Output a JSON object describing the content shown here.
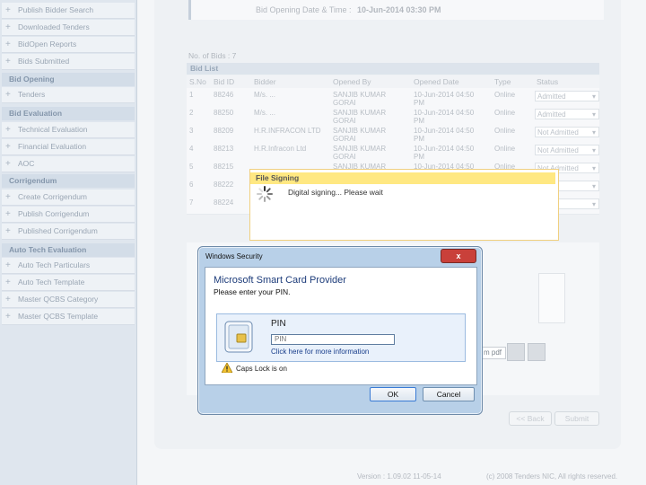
{
  "sidebar": {
    "items_top": [
      {
        "label": "Publish Bidder Search"
      },
      {
        "label": "Downloaded Tenders"
      },
      {
        "label": "BidOpen Reports"
      },
      {
        "label": "Bids Submitted"
      }
    ],
    "section_bid_opening": "Bid Opening",
    "bid_opening_items": [
      {
        "label": "Tenders"
      }
    ],
    "section_bid_evaluation": "Bid Evaluation",
    "bid_evaluation_items": [
      {
        "label": "Technical Evaluation"
      },
      {
        "label": "Financial Evaluation"
      },
      {
        "label": "AOC"
      }
    ],
    "section_corrigendum": "Corrigendum",
    "corrigendum_items": [
      {
        "label": "Create Corrigendum"
      },
      {
        "label": "Publish Corrigendum"
      },
      {
        "label": "Published Corrigendum"
      }
    ],
    "section_auto_tech": "Auto Tech Evaluation",
    "auto_tech_items": [
      {
        "label": "Auto Tech Particulars"
      },
      {
        "label": "Auto Tech Template"
      },
      {
        "label": "Master QCBS Category"
      },
      {
        "label": "Master QCBS Template"
      }
    ]
  },
  "main": {
    "opening_date_label": "Bid Opening Date & Time :",
    "opening_date_value": "10-Jun-2014 03:30 PM",
    "no_of_bids": "No. of Bids : 7",
    "bid_list_title": "Bid List",
    "columns": [
      "S.No",
      "Bid ID",
      "Bidder",
      "Opened By",
      "Opened Date",
      "Type",
      "Status"
    ],
    "rows": [
      {
        "sno": "1",
        "bid_id": "88246",
        "bidder": "M/s. ...",
        "opened_by": "SANJIB KUMAR GORAI",
        "opened_date": "10-Jun-2014 04:50 PM",
        "type": "Online",
        "status": "Admitted"
      },
      {
        "sno": "2",
        "bid_id": "88250",
        "bidder": "M/s. ...",
        "opened_by": "SANJIB KUMAR GORAI",
        "opened_date": "10-Jun-2014 04:50 PM",
        "type": "Online",
        "status": "Admitted"
      },
      {
        "sno": "3",
        "bid_id": "88209",
        "bidder": "H.R.INFRACON LTD",
        "opened_by": "SANJIB KUMAR GORAI",
        "opened_date": "10-Jun-2014 04:50 PM",
        "type": "Online",
        "status": "Not Admitted"
      },
      {
        "sno": "4",
        "bid_id": "88213",
        "bidder": "H.R.Infracon Ltd",
        "opened_by": "SANJIB KUMAR GORAI",
        "opened_date": "10-Jun-2014 04:50 PM",
        "type": "Online",
        "status": "Not Admitted"
      },
      {
        "sno": "5",
        "bid_id": "88215",
        "bidder": "",
        "opened_by": "SANJIB KUMAR",
        "opened_date": "10-Jun-2014 04:50",
        "type": "Online",
        "status": "Not Admitted"
      },
      {
        "sno": "6",
        "bid_id": "88222",
        "bidder": "",
        "opened_by": "",
        "opened_date": "",
        "type": "",
        "status": "...ted"
      },
      {
        "sno": "7",
        "bid_id": "88224",
        "bidder": "",
        "opened_by": "",
        "opened_date": "",
        "type": "",
        "status": "...ted"
      }
    ],
    "pdf_label": "m pdf",
    "back_label": "<< Back",
    "submit_label": "Submit"
  },
  "footer": {
    "version": "Version : 1.09.02 11-05-14",
    "copyright": "(c) 2008 Tenders NIC, All rights reserved."
  },
  "file_signing": {
    "title": "File Signing",
    "message": "Digital signing... Please wait"
  },
  "security_dialog": {
    "window_title": "Windows Security",
    "close_label": "x",
    "heading": "Microsoft Smart Card Provider",
    "subheading": "Please enter your PIN.",
    "pin_label": "PIN",
    "pin_placeholder": "PIN",
    "more_info": "Click here for more information",
    "caps_warning": "Caps Lock is on",
    "ok_label": "OK",
    "cancel_label": "Cancel"
  }
}
